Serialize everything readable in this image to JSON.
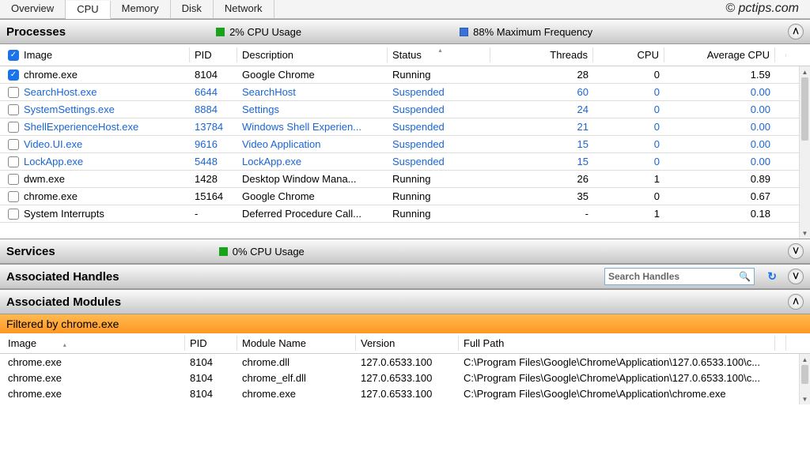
{
  "watermark": "© pctips.com",
  "tabs": [
    "Overview",
    "CPU",
    "Memory",
    "Disk",
    "Network"
  ],
  "active_tab": "CPU",
  "sections": {
    "processes": {
      "title": "Processes",
      "cpu_usage": "2% CPU Usage",
      "max_freq": "88% Maximum Frequency"
    },
    "services": {
      "title": "Services",
      "cpu_usage": "0% CPU Usage"
    },
    "handles": {
      "title": "Associated Handles",
      "search_placeholder": "Search Handles"
    },
    "modules": {
      "title": "Associated Modules",
      "filter": "Filtered by chrome.exe"
    }
  },
  "process_headers": [
    "Image",
    "PID",
    "Description",
    "Status",
    "Threads",
    "CPU",
    "Average CPU"
  ],
  "processes": [
    {
      "checked": true,
      "image": "chrome.exe",
      "pid": "8104",
      "desc": "Google Chrome",
      "status": "Running",
      "threads": "28",
      "cpu": "0",
      "avg": "1.59",
      "suspended": false
    },
    {
      "checked": false,
      "image": "SearchHost.exe",
      "pid": "6644",
      "desc": "SearchHost",
      "status": "Suspended",
      "threads": "60",
      "cpu": "0",
      "avg": "0.00",
      "suspended": true
    },
    {
      "checked": false,
      "image": "SystemSettings.exe",
      "pid": "8884",
      "desc": "Settings",
      "status": "Suspended",
      "threads": "24",
      "cpu": "0",
      "avg": "0.00",
      "suspended": true
    },
    {
      "checked": false,
      "image": "ShellExperienceHost.exe",
      "pid": "13784",
      "desc": "Windows Shell Experien...",
      "status": "Suspended",
      "threads": "21",
      "cpu": "0",
      "avg": "0.00",
      "suspended": true
    },
    {
      "checked": false,
      "image": "Video.UI.exe",
      "pid": "9616",
      "desc": "Video Application",
      "status": "Suspended",
      "threads": "15",
      "cpu": "0",
      "avg": "0.00",
      "suspended": true
    },
    {
      "checked": false,
      "image": "LockApp.exe",
      "pid": "5448",
      "desc": "LockApp.exe",
      "status": "Suspended",
      "threads": "15",
      "cpu": "0",
      "avg": "0.00",
      "suspended": true
    },
    {
      "checked": false,
      "image": "dwm.exe",
      "pid": "1428",
      "desc": "Desktop Window Mana...",
      "status": "Running",
      "threads": "26",
      "cpu": "1",
      "avg": "0.89",
      "suspended": false
    },
    {
      "checked": false,
      "image": "chrome.exe",
      "pid": "15164",
      "desc": "Google Chrome",
      "status": "Running",
      "threads": "35",
      "cpu": "0",
      "avg": "0.67",
      "suspended": false
    },
    {
      "checked": false,
      "image": "System Interrupts",
      "pid": "-",
      "desc": "Deferred Procedure Call...",
      "status": "Running",
      "threads": "-",
      "cpu": "1",
      "avg": "0.18",
      "suspended": false
    }
  ],
  "module_headers": [
    "Image",
    "PID",
    "Module Name",
    "Version",
    "Full Path"
  ],
  "modules": [
    {
      "image": "chrome.exe",
      "pid": "8104",
      "name": "chrome.dll",
      "version": "127.0.6533.100",
      "path": "C:\\Program Files\\Google\\Chrome\\Application\\127.0.6533.100\\c..."
    },
    {
      "image": "chrome.exe",
      "pid": "8104",
      "name": "chrome_elf.dll",
      "version": "127.0.6533.100",
      "path": "C:\\Program Files\\Google\\Chrome\\Application\\127.0.6533.100\\c..."
    },
    {
      "image": "chrome.exe",
      "pid": "8104",
      "name": "chrome.exe",
      "version": "127.0.6533.100",
      "path": "C:\\Program Files\\Google\\Chrome\\Application\\chrome.exe"
    }
  ]
}
